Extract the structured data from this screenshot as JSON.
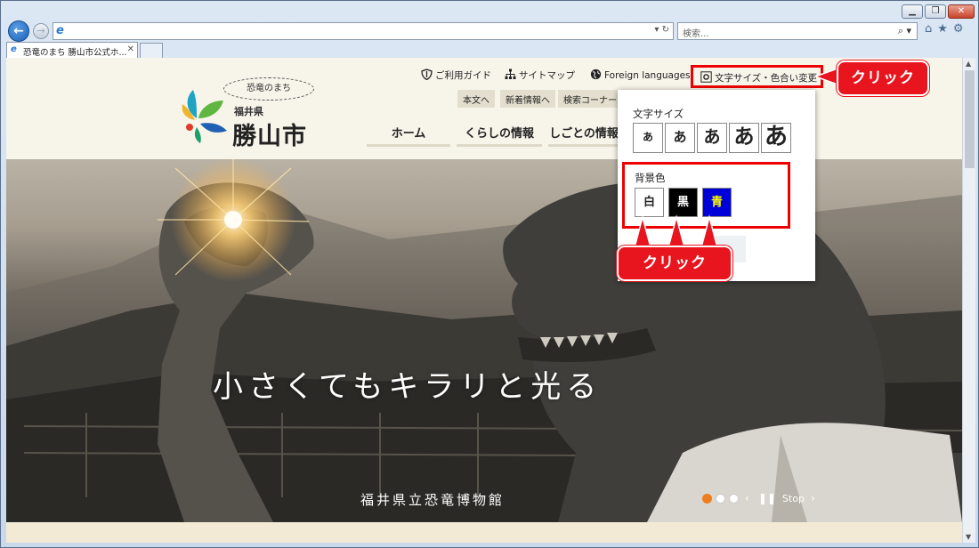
{
  "browser": {
    "address_value": "",
    "search_placeholder": "検索...",
    "tab_title": "恐竜のまち 勝山市公式ホ...",
    "window_controls": [
      "minimize",
      "restore",
      "close"
    ],
    "toolbar_icons": [
      "home-icon",
      "star-icon",
      "gear-icon"
    ]
  },
  "site": {
    "logo": {
      "tagline": "恐竜のまち",
      "prefecture": "福井県",
      "city": "勝山市"
    },
    "utility_links": {
      "guide": "ご利用ガイド",
      "sitemap": "サイトマップ",
      "foreign": "Foreign languages",
      "text_size_color": "文字サイズ・色合い変更"
    },
    "jump_links": [
      "本文へ",
      "新着情報へ",
      "検索コーナー"
    ],
    "global_nav": [
      "ホーム",
      "くらしの情報",
      "しごとの情報"
    ],
    "hero": {
      "title": "小さくてもキラリと光る",
      "caption": "福井県立恐竜博物館",
      "slider": {
        "dots": 3,
        "active_index": 0,
        "prev": "‹",
        "pause": "❚❚",
        "stop_label": "Stop",
        "next": "›"
      }
    }
  },
  "popup": {
    "font_size_label": "文字サイズ",
    "font_sizes": [
      "あ",
      "あ",
      "あ",
      "あ",
      "あ"
    ],
    "bg_label": "背景色",
    "bg_options": [
      {
        "label": "白",
        "bg": "#ffffff",
        "fg": "#222222"
      },
      {
        "label": "黒",
        "bg": "#000000",
        "fg": "#ffffff"
      },
      {
        "label": "青",
        "bg": "#0000d8",
        "fg": "#ffff00"
      }
    ]
  },
  "annotations": {
    "top_callout": "クリック",
    "bottom_callout": "クリック",
    "color": "#e8141e"
  }
}
